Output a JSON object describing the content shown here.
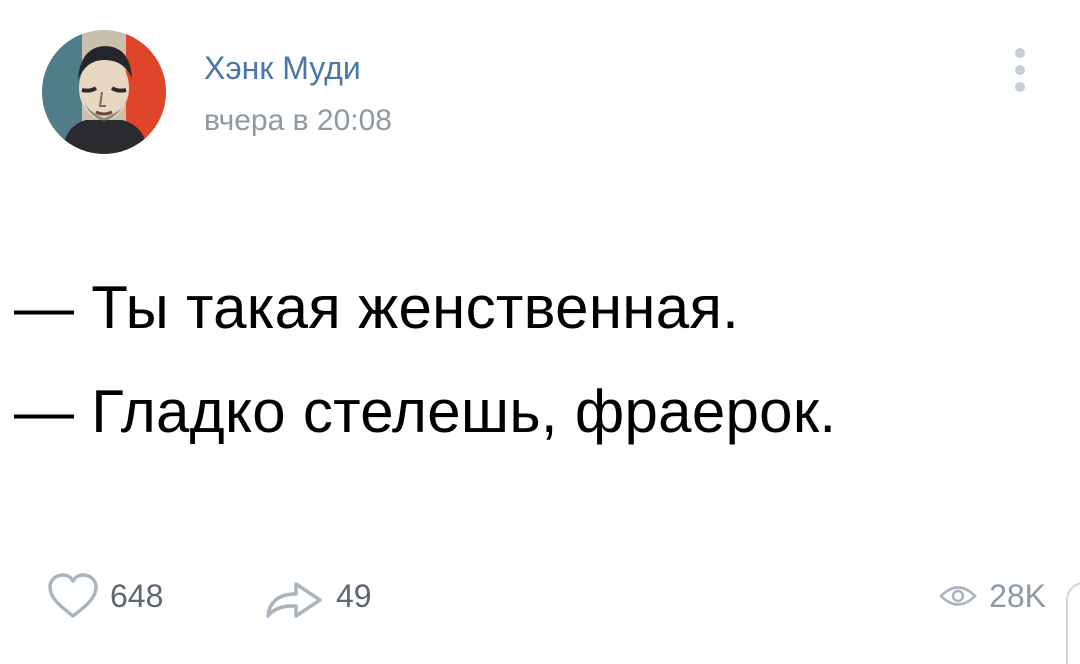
{
  "post": {
    "author_name": "Хэнк Муди",
    "timestamp": "вчера в 20:08",
    "text_lines": [
      "— Ты такая женственная.",
      "— Гладко стелешь, фраерок."
    ],
    "more_icon": "vertical-dots-icon"
  },
  "footer": {
    "likes": {
      "icon": "heart-icon",
      "count": "648"
    },
    "shares": {
      "icon": "share-arrow-icon",
      "count": "49"
    },
    "views": {
      "icon": "eye-icon",
      "count": "28K"
    }
  },
  "colors": {
    "author_link": "#4a76a8",
    "muted_text": "#8e99a6",
    "action_text": "#5c6773",
    "icon_stroke": "#aab4bf",
    "body_text": "#000000"
  }
}
